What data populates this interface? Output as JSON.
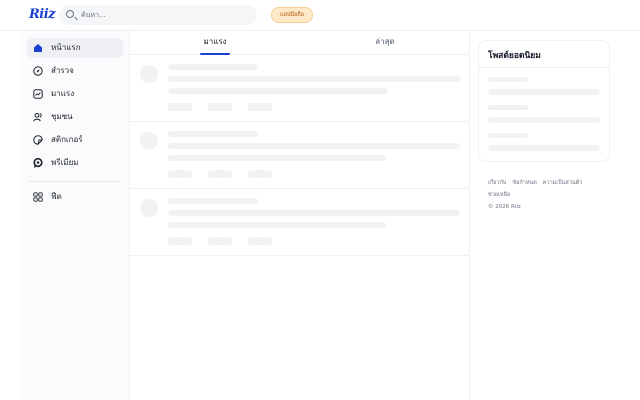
{
  "header": {
    "logo": "Riiz",
    "search_placeholder": "ค้นหา...",
    "app_button": "แอปมือถือ"
  },
  "sidebar": {
    "items": [
      {
        "label": "หน้าแรก",
        "icon": "home-icon",
        "active": true
      },
      {
        "label": "สำรวจ",
        "icon": "compass-icon",
        "active": false
      },
      {
        "label": "มาแรง",
        "icon": "trending-icon",
        "active": false
      },
      {
        "label": "ชุมชน",
        "icon": "community-icon",
        "active": false
      },
      {
        "label": "สติกเกอร์",
        "icon": "sticker-icon",
        "active": false
      },
      {
        "label": "พรีเมียม",
        "icon": "premium-icon",
        "active": false
      }
    ],
    "extra": {
      "label": "ฟีด",
      "icon": "grid-icon"
    }
  },
  "feed": {
    "tabs": [
      {
        "label": "มาแรง",
        "active": true
      },
      {
        "label": "ล่าสุด",
        "active": false
      }
    ]
  },
  "right_panel": {
    "popular_title": "โพสต์ยอดนิยม",
    "footer_links": [
      "เกี่ยวกับ",
      "ข้อกำหนด",
      "ความเป็นส่วนตัว",
      "ช่วยเหลือ"
    ],
    "copyright": "© 2026 Riiz"
  },
  "colors": {
    "accent": "#1a3fd1",
    "app_button_bg": "#fde8c8",
    "app_button_text": "#b45309",
    "skeleton": "#f1f2f4"
  }
}
